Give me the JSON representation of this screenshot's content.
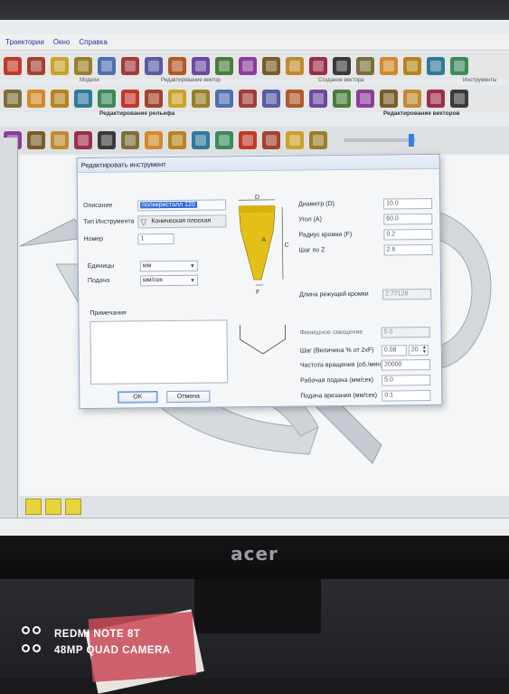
{
  "menubar": {
    "items": [
      "Траектории",
      "Окно",
      "Справка"
    ]
  },
  "toolbar_groups": [
    "Модели",
    "Редактирование вектор",
    "Создание вектора",
    "Инструменты"
  ],
  "toolbar_groups2": [
    "Редактирование рельефа",
    "Редактирование векторов"
  ],
  "colors": {
    "toolbar_icons": [
      "#c0392b",
      "#b05a2a",
      "#3a3a3a",
      "#a3422e",
      "#6b4aa0",
      "#7b6f3a",
      "#c9a227",
      "#4a7d3c",
      "#d18a2a",
      "#9a7f2a",
      "#8c3d99",
      "#b5841f",
      "#4e6fb0",
      "#7a5c28",
      "#2f7a9a",
      "#a23b3b",
      "#c08a2f",
      "#3d8a5a",
      "#5a5aa6",
      "#9a2f4a"
    ],
    "accent": "#2f6bd6",
    "swatch": "#e7d63b"
  },
  "dialog": {
    "title": "Редактировать инструмент",
    "description_label": "Описание",
    "description_value": "поликристалл 120",
    "tool_type_label": "Тип Инструмента",
    "tool_type_value": "Коническая плоская",
    "number_label": "Номер",
    "number_value": "1",
    "units_label": "Единицы",
    "units_value": "мм",
    "feed_label": "Подача",
    "feed_value": "мм/сек",
    "notes_label": "Примечания",
    "diameter_label": "Диаметр (D)",
    "diameter_value": "10.0",
    "angle_label": "Угол (A)",
    "angle_value": "60.0",
    "radius_label": "Радиус кромки (F)",
    "radius_value": "0.2",
    "stepz_label": "Шаг по Z",
    "stepz_value": "2.6",
    "cut_length_label": "Длина режущей кромки",
    "cut_length_value": "2.77128",
    "finish_offset_label": "Финишное смещение",
    "finish_offset_value": "5.0",
    "step_label": "Шаг (Величина  % от 2xF)",
    "step_value": "0.08",
    "step_percent": "20",
    "spindle_label": "Частота вращения (об./мин)",
    "spindle_value": "20000",
    "work_feed_label": "Рабочая подача (мм/сек)",
    "work_feed_value": "5.0",
    "plunge_feed_label": "Подача врезания (мм/сек)",
    "plunge_feed_value": "0.1",
    "ok_label": "OK",
    "cancel_label": "Отмена",
    "diagram_d": "D",
    "diagram_a": "A",
    "diagram_c": "C",
    "diagram_f": "F"
  },
  "monitor": {
    "brand": "acer"
  },
  "watermark": {
    "line1": "REDMI NOTE 8T",
    "line2": "48MP QUAD CAMERA"
  }
}
